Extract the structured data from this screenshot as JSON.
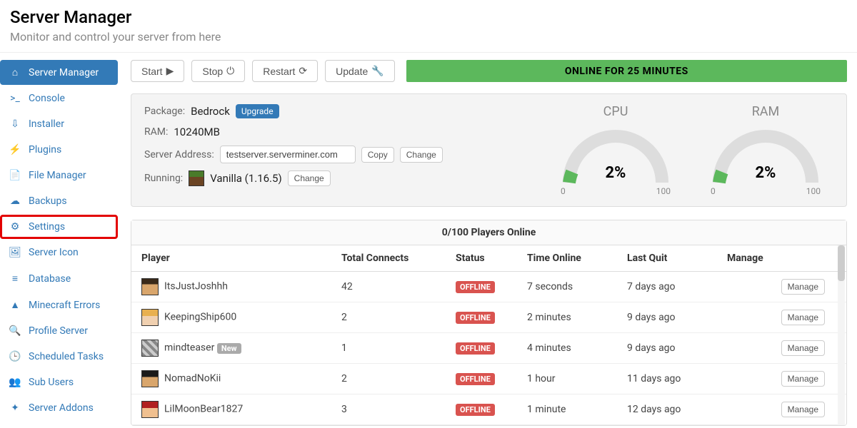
{
  "header": {
    "title": "Server Manager",
    "subtitle": "Monitor and control your server from here"
  },
  "sidebar": {
    "items": [
      {
        "label": "Server Manager"
      },
      {
        "label": "Console"
      },
      {
        "label": "Installer"
      },
      {
        "label": "Plugins"
      },
      {
        "label": "File Manager"
      },
      {
        "label": "Backups"
      },
      {
        "label": "Settings"
      },
      {
        "label": "Server Icon"
      },
      {
        "label": "Database"
      },
      {
        "label": "Minecraft Errors"
      },
      {
        "label": "Profile Server"
      },
      {
        "label": "Scheduled Tasks"
      },
      {
        "label": "Sub Users"
      },
      {
        "label": "Server Addons"
      }
    ]
  },
  "toolbar": {
    "start": "Start",
    "stop": "Stop",
    "restart": "Restart",
    "update": "Update"
  },
  "status_bar": "ONLINE FOR 25 MINUTES",
  "info": {
    "package_label": "Package:",
    "package_value": "Bedrock",
    "upgrade": "Upgrade",
    "ram_label": "RAM:",
    "ram_value": "10240MB",
    "addr_label": "Server Address:",
    "addr_value": "testserver.serverminer.com",
    "copy": "Copy",
    "change": "Change",
    "running_label": "Running:",
    "running_value": "Vanilla (1.16.5)"
  },
  "gauges": {
    "cpu": {
      "title": "CPU",
      "pct": "2%",
      "min": "0",
      "max": "100"
    },
    "ram": {
      "title": "RAM",
      "pct": "2%",
      "min": "0",
      "max": "100"
    }
  },
  "players": {
    "header": "0/100 Players Online",
    "columns": {
      "player": "Player",
      "connects": "Total Connects",
      "status": "Status",
      "time": "Time Online",
      "last": "Last Quit",
      "manage": "Manage"
    },
    "manage_btn": "Manage",
    "offline": "OFFLINE",
    "new": "New",
    "rows": [
      {
        "name": "ItsJustJoshhh",
        "connects": "42",
        "time": "7 seconds",
        "last": "7 days ago",
        "new": false
      },
      {
        "name": "KeepingShip600",
        "connects": "2",
        "time": "2 minutes",
        "last": "9 days ago",
        "new": false
      },
      {
        "name": "mindteaser",
        "connects": "1",
        "time": "4 minutes",
        "last": "9 days ago",
        "new": true
      },
      {
        "name": "NomadNoKii",
        "connects": "2",
        "time": "1 hour",
        "last": "11 days ago",
        "new": false
      },
      {
        "name": "LilMoonBear1827",
        "connects": "3",
        "time": "1 minute",
        "last": "12 days ago",
        "new": false
      }
    ]
  }
}
